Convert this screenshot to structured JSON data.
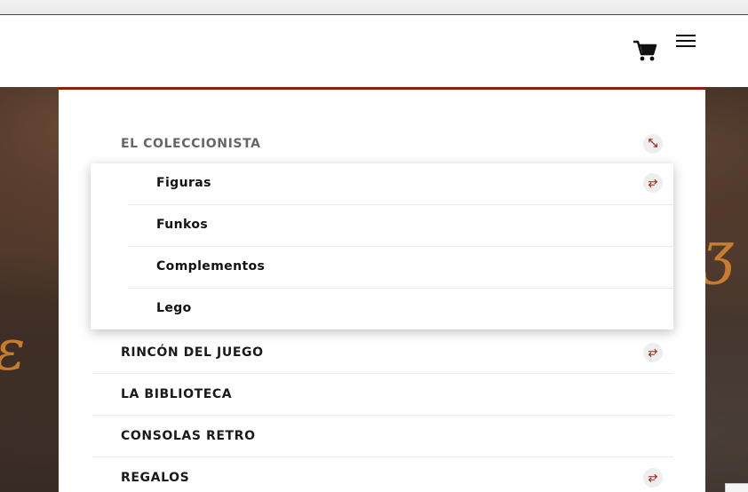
{
  "header": {
    "cart_icon": "cart-icon",
    "menu_icon": "hamburger-icon"
  },
  "menu": {
    "items": [
      {
        "label": "EL COLECCIONISTA",
        "expanded": true,
        "toggle_icon": "collapse-arrows-icon"
      },
      {
        "label": "RINCÓN DEL JUEGO",
        "expanded": false,
        "toggle_icon": "expand-arrows-icon"
      },
      {
        "label": "LA BIBLIOTECA",
        "expanded": false
      },
      {
        "label": "CONSOLAS RETRO",
        "expanded": false
      },
      {
        "label": "REGALOS",
        "expanded": false,
        "toggle_icon": "expand-arrows-icon"
      }
    ],
    "submenu": [
      {
        "label": "Figuras",
        "toggle_icon": "expand-arrows-icon"
      },
      {
        "label": "Funkos"
      },
      {
        "label": "Complementos"
      },
      {
        "label": "Lego"
      }
    ]
  },
  "colors": {
    "accent": "#8f1f10",
    "toggle": "#a0281a"
  }
}
